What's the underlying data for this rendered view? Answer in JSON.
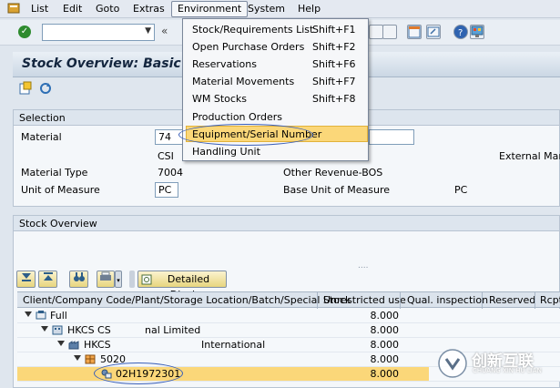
{
  "menubar": {
    "items": [
      "List",
      "Edit",
      "Goto",
      "Extras",
      "Environment",
      "System",
      "Help"
    ]
  },
  "dropdown": {
    "items": [
      {
        "label": "Stock/Requirements List",
        "shortcut": "Shift+F1"
      },
      {
        "label": "Open Purchase Orders",
        "shortcut": "Shift+F2"
      },
      {
        "label": "Reservations",
        "shortcut": "Shift+F6"
      },
      {
        "label": "Material Movements",
        "shortcut": "Shift+F7"
      },
      {
        "label": "WM Stocks",
        "shortcut": "Shift+F8"
      },
      {
        "label": "Production Orders",
        "shortcut": ""
      },
      {
        "label": "Equipment/Serial Number",
        "shortcut": ""
      },
      {
        "label": "Handling Unit",
        "shortcut": ""
      }
    ]
  },
  "title": "Stock Overview: Basic",
  "selection": {
    "header": "Selection",
    "material_label": "Material",
    "material_value": "74",
    "csi_text": "CSI",
    "external_label": "External Manu",
    "material_type_label": "Material Type",
    "material_type_value": "7004",
    "other_revenue": "Other Revenue-BOS",
    "uom_label": "Unit of Measure",
    "uom_value": "PC",
    "base_uom_label": "Base Unit of Measure",
    "base_uom_value": "PC"
  },
  "stock_overview": {
    "header": "Stock Overview",
    "resize_dots": "....",
    "detailed_display": "Detailed Display",
    "columns": [
      "Client/Company Code/Plant/Storage Location/Batch/Special Stock",
      "Unrestricted use",
      "Qual. inspection",
      "Reserved",
      "Rcpt"
    ],
    "rows": [
      {
        "label": "Full",
        "unrestricted": "8.000"
      },
      {
        "label": "HKCS CS",
        "suffix": "nal Limited",
        "unrestricted": "8.000"
      },
      {
        "label": "HKCS",
        "suffix": "International",
        "unrestricted": "8.000"
      },
      {
        "label": "5020",
        "suffix": "",
        "unrestricted": "8.000"
      },
      {
        "label": "02H1972301",
        "unrestricted": "8.000"
      }
    ]
  },
  "watermark": {
    "line1": "创新互联",
    "line2": "CHUANG XIN HU LIAN"
  }
}
